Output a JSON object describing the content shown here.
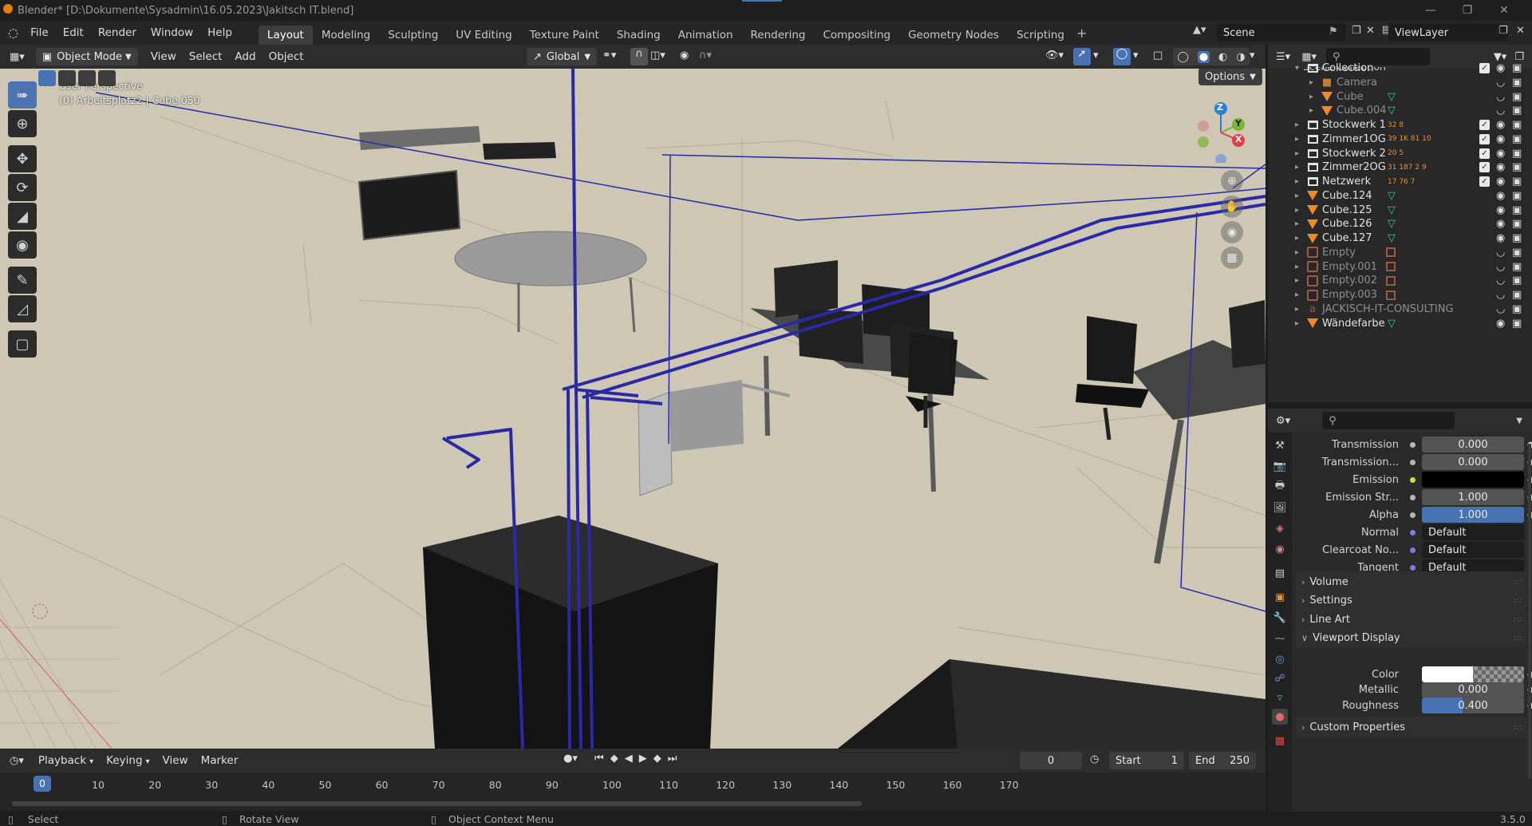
{
  "window": {
    "title": "Blender* [D:\\Dokumente\\Sysadmin\\16.05.2023\\Jakitsch IT.blend]"
  },
  "menus": [
    "File",
    "Edit",
    "Render",
    "Window",
    "Help"
  ],
  "workspaces": [
    "Layout",
    "Modeling",
    "Sculpting",
    "UV Editing",
    "Texture Paint",
    "Shading",
    "Animation",
    "Rendering",
    "Compositing",
    "Geometry Nodes",
    "Scripting"
  ],
  "active_workspace": "Layout",
  "scene": {
    "name": "Scene",
    "view_layer": "ViewLayer"
  },
  "viewport_header": {
    "mode": "Object Mode",
    "menus": [
      "View",
      "Select",
      "Add",
      "Object"
    ],
    "orientation": "Global",
    "options": "Options"
  },
  "viewport": {
    "perspective": "User Perspective",
    "context": "(0) Arbeitsplatz2 | Cube.050",
    "gizmo_axes": [
      "Z",
      "Y",
      "X"
    ]
  },
  "outliner": {
    "search_placeholder": "",
    "root": "Scene Collection",
    "rows": [
      {
        "label": "Collection",
        "type": "collection",
        "indent": 0,
        "checked": true,
        "dim": false,
        "badges": ""
      },
      {
        "label": "Camera",
        "type": "camera",
        "indent": 1,
        "checked": false,
        "dim": true,
        "badges": ""
      },
      {
        "label": "Cube",
        "type": "mesh",
        "indent": 1,
        "checked": false,
        "dim": true,
        "badges": ""
      },
      {
        "label": "Cube.004",
        "type": "mesh",
        "indent": 1,
        "checked": false,
        "dim": true,
        "badges": ""
      },
      {
        "label": "Stockwerk 1",
        "type": "collection",
        "indent": 0,
        "checked": true,
        "dim": false,
        "badges": "32 8"
      },
      {
        "label": "Zimmer1OG",
        "type": "collection",
        "indent": 0,
        "checked": true,
        "dim": false,
        "badges": "39 1K 81 10"
      },
      {
        "label": "Stockwerk 2",
        "type": "collection",
        "indent": 0,
        "checked": true,
        "dim": false,
        "badges": "20 5"
      },
      {
        "label": "Zimmer2OG",
        "type": "collection",
        "indent": 0,
        "checked": true,
        "dim": false,
        "badges": "31 187 2 9"
      },
      {
        "label": "Netzwerk",
        "type": "collection",
        "indent": 0,
        "checked": true,
        "dim": false,
        "badges": "17 76 7"
      },
      {
        "label": "Cube.124",
        "type": "mesh",
        "indent": 0,
        "checked": false,
        "dim": false,
        "badges": ""
      },
      {
        "label": "Cube.125",
        "type": "mesh",
        "indent": 0,
        "checked": false,
        "dim": false,
        "badges": ""
      },
      {
        "label": "Cube.126",
        "type": "mesh",
        "indent": 0,
        "checked": false,
        "dim": false,
        "badges": ""
      },
      {
        "label": "Cube.127",
        "type": "mesh",
        "indent": 0,
        "checked": false,
        "dim": false,
        "badges": ""
      },
      {
        "label": "Empty",
        "type": "empty",
        "indent": 0,
        "checked": false,
        "dim": true,
        "badges": ""
      },
      {
        "label": "Empty.001",
        "type": "empty",
        "indent": 0,
        "checked": false,
        "dim": true,
        "badges": ""
      },
      {
        "label": "Empty.002",
        "type": "empty",
        "indent": 0,
        "checked": false,
        "dim": true,
        "badges": ""
      },
      {
        "label": "Empty.003",
        "type": "empty",
        "indent": 0,
        "checked": false,
        "dim": true,
        "badges": ""
      },
      {
        "label": "JACKISCH-IT-CONSULTING",
        "type": "text",
        "indent": 0,
        "checked": false,
        "dim": true,
        "badges": ""
      },
      {
        "label": "Wändefarbe",
        "type": "mesh",
        "indent": 0,
        "checked": false,
        "dim": false,
        "badges": ""
      }
    ]
  },
  "properties": {
    "rows": [
      {
        "label": "Transmission",
        "value": "0.000",
        "kind": "num"
      },
      {
        "label": "Transmission...",
        "value": "0.000",
        "kind": "num"
      },
      {
        "label": "Emission",
        "value": "",
        "kind": "color_black"
      },
      {
        "label": "Emission Str...",
        "value": "1.000",
        "kind": "num"
      },
      {
        "label": "Alpha",
        "value": "1.000",
        "kind": "num_blue"
      },
      {
        "label": "Normal",
        "value": "Default",
        "kind": "link"
      },
      {
        "label": "Clearcoat No...",
        "value": "Default",
        "kind": "link"
      },
      {
        "label": "Tangent",
        "value": "Default",
        "kind": "link"
      }
    ],
    "sections": [
      "Volume",
      "Settings",
      "Line Art",
      "Viewport Display"
    ],
    "viewport_display": [
      {
        "label": "Color",
        "value": "",
        "kind": "color_white"
      },
      {
        "label": "Metallic",
        "value": "0.000",
        "kind": "num"
      },
      {
        "label": "Roughness",
        "value": "0.400",
        "kind": "num_blue"
      }
    ],
    "roughness_fill": 0.4,
    "last_section": "Custom Properties"
  },
  "timeline": {
    "menus": [
      "Playback",
      "Keying",
      "View",
      "Marker"
    ],
    "current_frame": "0",
    "start_label": "Start",
    "start": "1",
    "end_label": "End",
    "end": "250",
    "ticks": [
      "0",
      "10",
      "20",
      "30",
      "40",
      "50",
      "60",
      "70",
      "80",
      "90",
      "100",
      "110",
      "120",
      "130",
      "140",
      "150",
      "160",
      "170"
    ]
  },
  "status": {
    "select": "Select",
    "rotate": "Rotate View",
    "context": "Object Context Menu",
    "version": "3.5.0"
  },
  "colors": {
    "accent": "#4772b3",
    "wire": "#2a2aa8",
    "floor": "#cbc5b0"
  }
}
